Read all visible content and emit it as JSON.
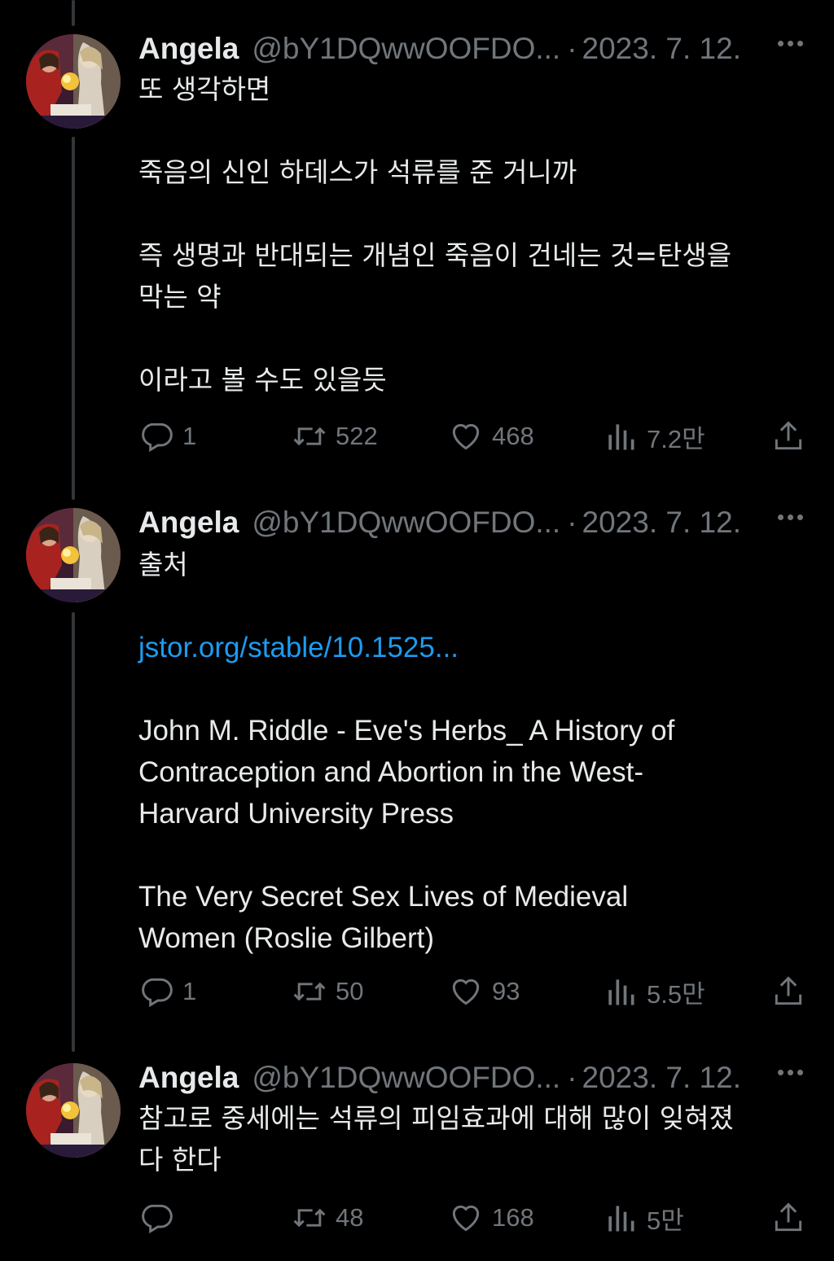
{
  "tweets": [
    {
      "name": "Angela",
      "handle": "@bY1DQwwOOFDO...",
      "separator": "·",
      "date": "2023. 7. 12.",
      "lines": [
        "또 생각하면",
        "",
        "죽음의 신인 하데스가 석류를 준 거니까",
        "",
        "즉 생명과 반대되는 개념인 죽음이 건네는 것=탄생을",
        "막는 약",
        "",
        "이라고 볼 수도 있을듯"
      ],
      "replies": "1",
      "retweets": "522",
      "likes": "468",
      "views": "7.2만"
    },
    {
      "name": "Angela",
      "handle": "@bY1DQwwOOFDO...",
      "separator": "·",
      "date": "2023. 7. 12.",
      "first_line": "출처",
      "link": "jstor.org/stable/10.1525...",
      "source1": "John M. Riddle - Eve's Herbs_ A History of\nContraception and Abortion in the West-\nHarvard University Press",
      "source2": "The Very Secret Sex Lives of Medieval\nWomen (Roslie Gilbert)",
      "replies": "1",
      "retweets": "50",
      "likes": "93",
      "views": "5.5만"
    },
    {
      "name": "Angela",
      "handle": "@bY1DQwwOOFDO...",
      "separator": "·",
      "date": "2023. 7. 12.",
      "lines": [
        "참고로 중세에는 석류의 피임효과에 대해 많이 잊혀졌",
        "다 한다"
      ],
      "replies": "",
      "retweets": "48",
      "likes": "168",
      "views": "5만"
    }
  ],
  "icons": [
    "reply-icon",
    "retweet-icon",
    "like-icon",
    "views-icon",
    "share-icon",
    "more-icon"
  ],
  "colors": {
    "background": "#000000",
    "text": "#e7e9ea",
    "muted": "#71767b",
    "link": "#1d9bf0",
    "thread_line": "#333639"
  }
}
